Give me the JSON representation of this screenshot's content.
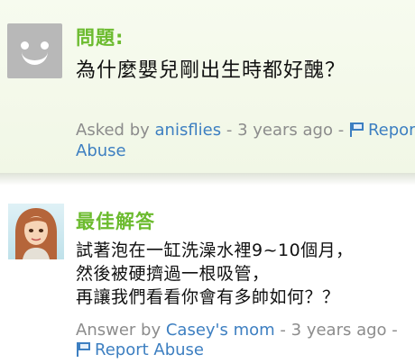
{
  "question": {
    "heading": "問題:",
    "text": "為什麼嬰兒剛出生時都好醜？",
    "meta_prefix": "Asked by",
    "author": "anisflies",
    "separator": "-",
    "time": "3 years ago",
    "report_label": "Report",
    "report_label_2": "Abuse"
  },
  "answer": {
    "heading": "最佳解答",
    "lines": [
      "試著泡在一缸洗澡水裡9~10個月，",
      "然後被硬擠過一根吸管，",
      "再讓我們看看你會有多帥如何？？"
    ],
    "meta_prefix": "Answer by",
    "author": "Casey's mom",
    "separator": "-",
    "time": "3 years ago",
    "report_label": "Report Abuse"
  },
  "colors": {
    "accent_green": "#6cbb2f",
    "link_blue": "#3d7fc1",
    "meta_gray": "#8c8c8c"
  }
}
